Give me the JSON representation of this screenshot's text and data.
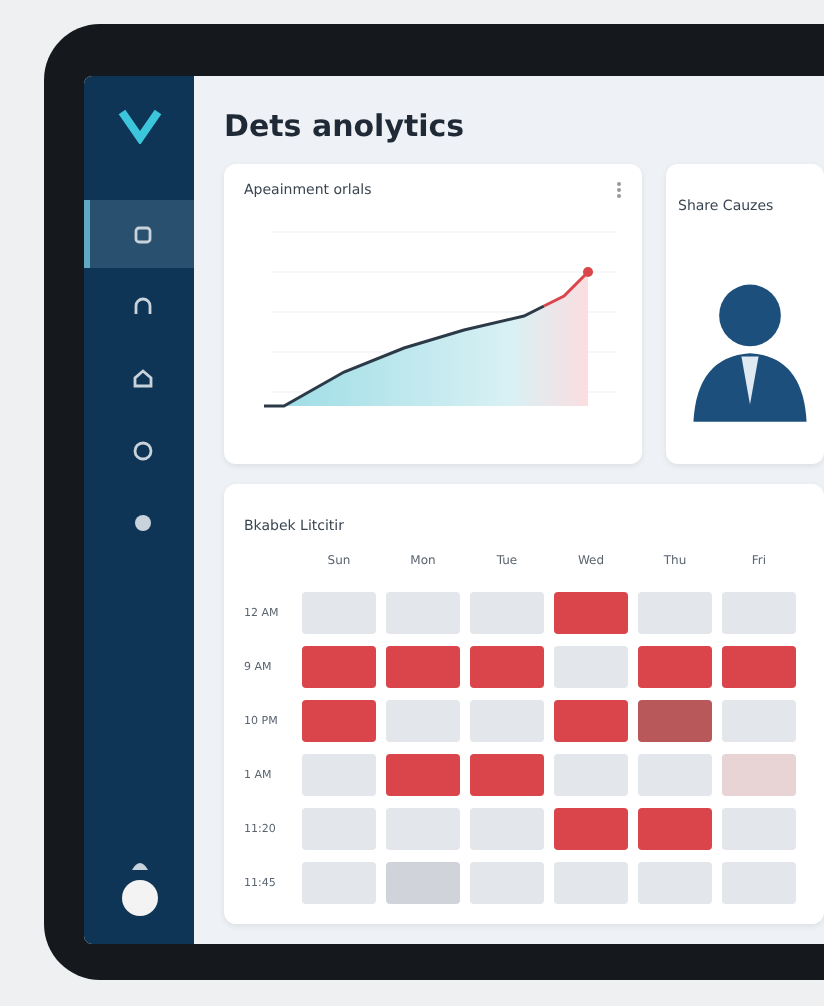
{
  "sidebar": {
    "items": [
      {
        "selected": true
      },
      {
        "selected": false
      },
      {
        "selected": false
      },
      {
        "selected": false
      },
      {
        "selected": false
      }
    ]
  },
  "title": "Dets anolytics",
  "cards": [
    {
      "title": "Apeainment orlals",
      "kind": "chart"
    },
    {
      "title": "Share Cauzes",
      "kind": "person"
    }
  ],
  "schedule": {
    "title": "Bkabek Litcitir",
    "columns": [
      "Sun",
      "Mon",
      "Tue",
      "Wed",
      "Thu",
      "Fri"
    ],
    "rows": [
      {
        "label": "12 AM",
        "cells": [
          {
            "color": "#e3e6ea"
          },
          {
            "color": "#e3e6ea"
          },
          {
            "color": "#e3e6ea"
          },
          {
            "color": "#d9454a"
          },
          {
            "color": "#e3e6ea"
          },
          {
            "color": "#e3e6ea"
          }
        ]
      },
      {
        "label": "9 AM",
        "cells": [
          {
            "color": "#d9454a"
          },
          {
            "color": "#d9454a"
          },
          {
            "color": "#d9454a"
          },
          {
            "color": "#e3e6ea"
          },
          {
            "color": "#d9454a"
          },
          {
            "color": "#d9454a"
          }
        ]
      },
      {
        "label": "10 PM",
        "cells": [
          {
            "color": "#d9454a"
          },
          {
            "color": "#e3e6ea"
          },
          {
            "color": "#e3e6ea"
          },
          {
            "color": "#d9454a"
          },
          {
            "color": "#b8585a"
          },
          {
            "color": "#e3e6ea"
          }
        ]
      },
      {
        "label": "1 AM",
        "cells": [
          {
            "color": "#e3e6ea"
          },
          {
            "color": "#d9454a"
          },
          {
            "color": "#d9454a"
          },
          {
            "color": "#e3e6ea"
          },
          {
            "color": "#e3e6ea"
          },
          {
            "color": "#e8d3d5"
          }
        ]
      },
      {
        "label": "11:20",
        "cells": [
          {
            "color": "#e3e6ea"
          },
          {
            "color": "#e3e6ea"
          },
          {
            "color": "#e3e6ea"
          },
          {
            "color": "#d9454a"
          },
          {
            "color": "#d9454a"
          },
          {
            "color": "#e3e6ea"
          }
        ]
      },
      {
        "label": "11:45",
        "cells": [
          {
            "color": "#e3e6ea"
          },
          {
            "color": "#d0d4da"
          },
          {
            "color": "#e3e6ea"
          },
          {
            "color": "#e3e6ea"
          },
          {
            "color": "#e3e6ea"
          },
          {
            "color": "#e3e6ea"
          }
        ]
      }
    ]
  }
}
